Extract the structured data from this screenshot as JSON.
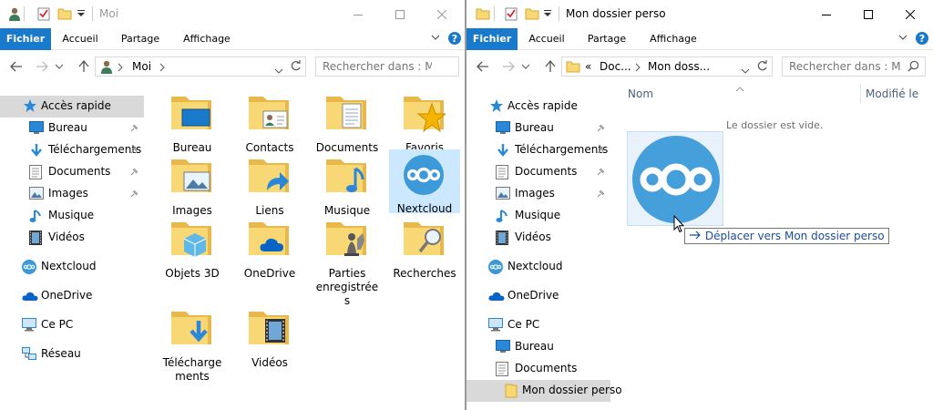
{
  "left": {
    "title": "Moi",
    "tabs": [
      "Fichier",
      "Accueil",
      "Partage",
      "Affichage"
    ],
    "address": {
      "crumb": "Moi"
    },
    "search": {
      "placeholder": "Rechercher dans : Moi"
    },
    "nav": [
      {
        "label": "Accès rapide",
        "icon": "star-icon",
        "pinned": false
      },
      {
        "label": "Bureau",
        "icon": "desktop-icon",
        "pinned": true
      },
      {
        "label": "Téléchargements",
        "icon": "download-icon",
        "pinned": true
      },
      {
        "label": "Documents",
        "icon": "documents-icon",
        "pinned": true
      },
      {
        "label": "Images",
        "icon": "images-icon",
        "pinned": true
      },
      {
        "label": "Musique",
        "icon": "music-icon",
        "pinned": false
      },
      {
        "label": "Vidéos",
        "icon": "videos-icon",
        "pinned": false
      },
      {
        "label": "Nextcloud",
        "icon": "nextcloud-icon",
        "pinned": false
      },
      {
        "label": "OneDrive",
        "icon": "onedrive-icon",
        "pinned": false
      },
      {
        "label": "Ce PC",
        "icon": "computer-icon",
        "pinned": false
      },
      {
        "label": "Réseau",
        "icon": "network-icon",
        "pinned": false
      }
    ],
    "tiles": [
      {
        "label": "Bureau",
        "icon": "desktop-folder-icon"
      },
      {
        "label": "Contacts",
        "icon": "contacts-folder-icon"
      },
      {
        "label": "Documents",
        "icon": "documents-folder-icon"
      },
      {
        "label": "Favoris",
        "icon": "favorites-folder-icon"
      },
      {
        "label": "Images",
        "icon": "images-folder-icon"
      },
      {
        "label": "Liens",
        "icon": "links-folder-icon"
      },
      {
        "label": "Musique",
        "icon": "music-folder-icon"
      },
      {
        "label": "Nextcloud",
        "icon": "nextcloud-folder-icon"
      },
      {
        "label": "Objets 3D",
        "icon": "3d-objects-folder-icon"
      },
      {
        "label": "OneDrive",
        "icon": "onedrive-folder-icon"
      },
      {
        "label": "Parties enregistrée s",
        "icon": "saved-games-folder-icon"
      },
      {
        "label": "Recherches",
        "icon": "searches-folder-icon"
      },
      {
        "label": "Télécharge ments",
        "icon": "downloads-folder-icon"
      },
      {
        "label": "Vidéos",
        "icon": "videos-folder-icon"
      }
    ]
  },
  "right": {
    "title": "Mon dossier perso",
    "tabs": [
      "Fichier",
      "Accueil",
      "Partage",
      "Affichage"
    ],
    "address": {
      "prefix": "«",
      "crumb1": "Doc...",
      "crumb2": "Mon doss..."
    },
    "search": {
      "placeholder": "Rechercher dans : M..."
    },
    "columns": {
      "name": "Nom",
      "modified": "Modifié le"
    },
    "empty_message": "Le dossier est vide.",
    "drag_tooltip": {
      "action": "Déplacer vers",
      "target": "Mon dossier perso"
    },
    "nav": [
      {
        "label": "Accès rapide",
        "icon": "star-icon",
        "pinned": false
      },
      {
        "label": "Bureau",
        "icon": "desktop-icon",
        "pinned": true
      },
      {
        "label": "Téléchargements",
        "icon": "download-icon",
        "pinned": true
      },
      {
        "label": "Documents",
        "icon": "documents-icon",
        "pinned": true
      },
      {
        "label": "Images",
        "icon": "images-icon",
        "pinned": true
      },
      {
        "label": "Musique",
        "icon": "music-icon",
        "pinned": false
      },
      {
        "label": "Vidéos",
        "icon": "videos-icon",
        "pinned": false
      },
      {
        "label": "Nextcloud",
        "icon": "nextcloud-icon",
        "pinned": false
      },
      {
        "label": "OneDrive",
        "icon": "onedrive-icon",
        "pinned": false
      },
      {
        "label": "Ce PC",
        "icon": "computer-icon",
        "pinned": false
      },
      {
        "label": "Bureau",
        "icon": "desktop-icon",
        "pinned": false
      },
      {
        "label": "Documents",
        "icon": "documents-icon",
        "pinned": false
      },
      {
        "label": "Mon dossier perso",
        "icon": "folder-icon",
        "pinned": false
      }
    ]
  },
  "colors": {
    "accent": "#1979ca",
    "selection": "#cce8ff",
    "nextcloud": "#3c9ad9",
    "folder": "#f8d775"
  }
}
